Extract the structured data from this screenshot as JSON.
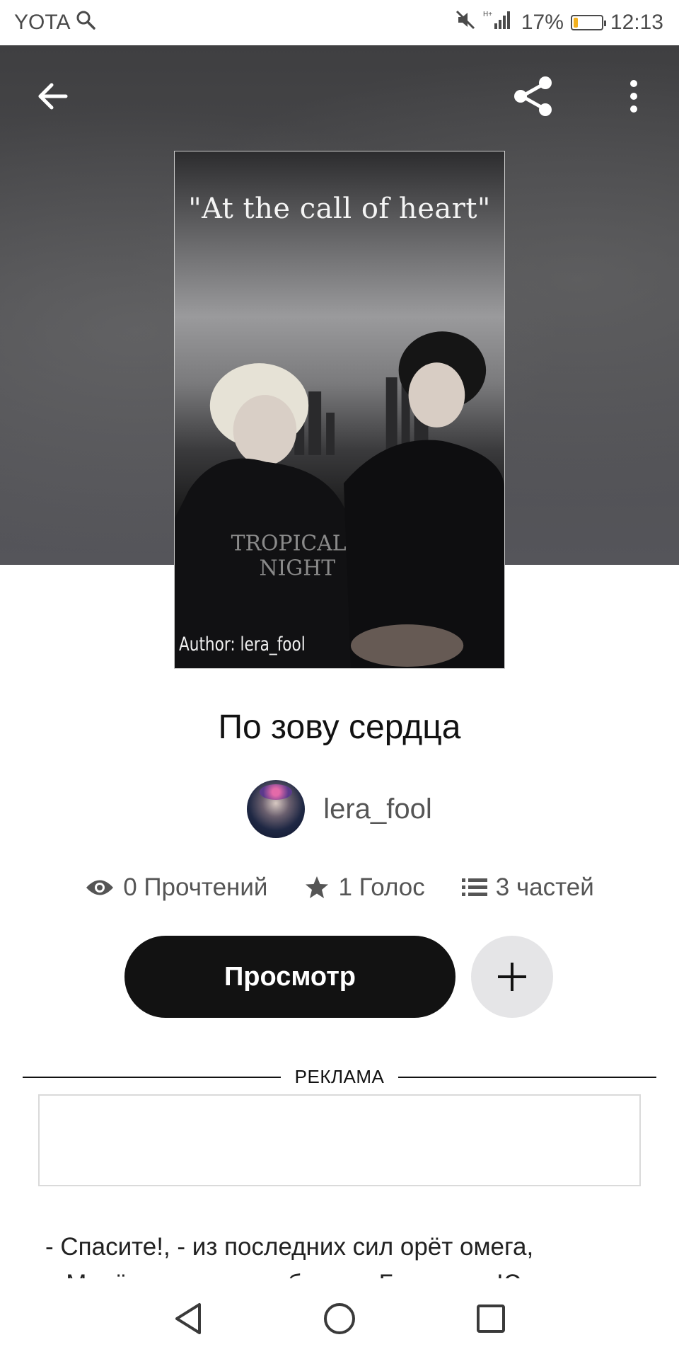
{
  "status_bar": {
    "carrier": "YOTA",
    "network": "H+",
    "battery_percent": "17%",
    "battery_level": 0.17,
    "time": "12:13"
  },
  "cover": {
    "title": "\"At the call of heart\"",
    "author": "Author: lera_fool"
  },
  "story": {
    "title": "По зову сердца",
    "author": "lera_fool",
    "stats": {
      "reads": "0 Прочтений",
      "votes": "1 Голос",
      "parts": "3 частей"
    },
    "read_button": "Просмотр",
    "ad_label": "РЕКЛАМА",
    "description_line1": "- Спасите!, - из последних сил орёт омега,",
    "description_line2": "а Минён уже совсем близко. Будь хоть Юнги и спасёт"
  },
  "icons": {
    "back": "arrow-left-icon",
    "share": "share-icon",
    "more": "more-vertical-icon",
    "eye": "eye-icon",
    "star": "star-icon",
    "list": "list-icon",
    "add": "plus-icon"
  },
  "colors": {
    "primary_button": "#121212",
    "secondary_button": "#e5e5e7",
    "text": "#121212",
    "muted_text": "#555555"
  }
}
